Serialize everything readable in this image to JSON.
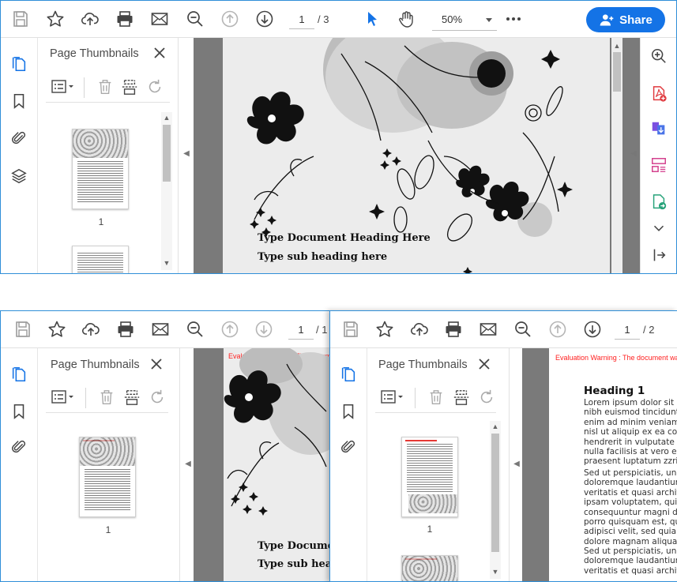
{
  "top_window": {
    "current_page": "1",
    "page_total": "/ 3",
    "zoom": "50%",
    "share_label": "Share",
    "panel_title": "Page Thumbnails",
    "thumb_label_1": "1",
    "doc_heading": "Type Document Heading Here",
    "doc_subheading": "Type sub heading here"
  },
  "bottom_left_window": {
    "current_page": "1",
    "page_total": "/ 1",
    "panel_title": "Page Thumbnails",
    "thumb_label_1": "1",
    "warning": "Evaluation Warning : The document w",
    "doc_heading": "Type Docume",
    "doc_subheading": "Type sub hea"
  },
  "bottom_right_window": {
    "current_page": "1",
    "page_total": "/ 2",
    "panel_title": "Page Thumbnails",
    "thumb_label_1": "1",
    "warning": "Evaluation Warning : The document was cre",
    "heading": "Heading 1",
    "para1": "Lorem ipsum dolor sit a\nnibh euismod tincidunt u\nenim ad minim veniam,\nnisl ut aliquip ex ea con\nhendrerit in vulputate ve\nnulla facilisis at vero e\npraesent luptatum zzril c",
    "para2": "Sed ut perspiciatis, und\ndoloremque laudantium,\nveritatis et quasi archit\nipsam voluptatem, quia\nconsequuntur magni dol\nporro quisquam est, qu\nadipisci velit, sed quia n\ndolore magnam aliquam",
    "para3": "Sed ut perspiciatis, und\ndoloremque laudantium,\nveritatis et quasi archit"
  },
  "colors": {
    "accent": "#1473e6",
    "icon": "#444444",
    "rail_active": "#1473e6",
    "warning": "#ff2020"
  }
}
